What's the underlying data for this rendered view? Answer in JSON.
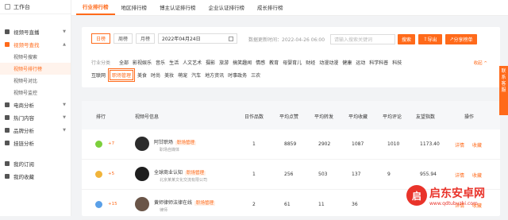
{
  "sidebar": {
    "title": "工作台",
    "groups": [
      {
        "label": "视频号直播",
        "open": false
      },
      {
        "label": "视频号查找",
        "open": true,
        "active": true,
        "items": [
          {
            "label": "视频号搜索",
            "active": false
          },
          {
            "label": "视频号排行榜",
            "active": true
          },
          {
            "label": "视频号对比",
            "active": false
          },
          {
            "label": "视频号监控",
            "active": false
          }
        ]
      },
      {
        "label": "电商分析"
      },
      {
        "label": "热门内容"
      },
      {
        "label": "品牌分析"
      },
      {
        "label": "挂链分析"
      },
      {
        "label": "我的订阅"
      },
      {
        "label": "我的收藏"
      }
    ]
  },
  "tabs": [
    {
      "label": "行业排行榜",
      "active": true
    },
    {
      "label": "地区排行榜"
    },
    {
      "label": "博主认证排行榜"
    },
    {
      "label": "企业认证排行榜"
    },
    {
      "label": "成长排行榜"
    }
  ],
  "filters": {
    "period": [
      "日榜",
      "周榜",
      "月榜"
    ],
    "active_period": "日榜",
    "date": "2022年04月24日",
    "update_time": "数据更新时间：2022-04-26 06:00",
    "search_placeholder": "请输入搜索关键词",
    "search_btn": "搜索",
    "export_btn": "导出",
    "share_btn": "分享榜单"
  },
  "categories": {
    "label": "行业分类",
    "row1": [
      "全部",
      "影视娱乐",
      "音乐",
      "生活",
      "人文艺术",
      "摄影",
      "旅游",
      "搞笑趣闻",
      "情感",
      "教育",
      "母婴育儿",
      "财经",
      "动漫动漫",
      "健康",
      "运动",
      "科学科普",
      "科技"
    ],
    "row2": [
      "互联网",
      "职场管理",
      "美食",
      "时尚",
      "美妆",
      "萌宠",
      "汽车",
      "地方资讯",
      "时事政务",
      "三农"
    ],
    "highlighted": "职场管理",
    "expand": "收起"
  },
  "table": {
    "headers": [
      "排行",
      "视频号信息",
      "日作品数",
      "平均点赞",
      "平均转发",
      "平均收藏",
      "平均评论",
      "友望指数",
      "操作"
    ],
    "rows": [
      {
        "change": "+7",
        "medal": "#7ccf3c",
        "name": "阿甘职场",
        "tag": "职场管理",
        "sub": "职场自媒体",
        "works": "1",
        "likes": "8859",
        "shares": "2902",
        "favs": "1087",
        "comments": "1010",
        "index": "1173.40",
        "avatar": "#2b2b2b",
        "avatar_text": "阿"
      },
      {
        "change": "+5",
        "medal": "#f1b43a",
        "name": "全球商业认知",
        "tag": "职场管理",
        "sub": "北京某某文化交流有限公司",
        "works": "1",
        "likes": "256",
        "shares": "503",
        "favs": "137",
        "comments": "9",
        "index": "955.94",
        "avatar": "#1e1e1e",
        "avatar_text": "GB"
      },
      {
        "change": "+15",
        "medal": "#5aa0e8",
        "name": "黄师律师法律在线",
        "tag": "职场管理",
        "sub": "律师",
        "works": "2",
        "likes": "61",
        "shares": "11",
        "favs": "36",
        "comments": "",
        "index": "",
        "avatar": "#6a5548",
        "avatar_text": "黄"
      }
    ],
    "actions": [
      "详情",
      "收藏"
    ]
  },
  "float_btn": "联系客服",
  "watermark": {
    "t1": "启东安卓网",
    "t2": "www.qdtubuzhi.com"
  }
}
